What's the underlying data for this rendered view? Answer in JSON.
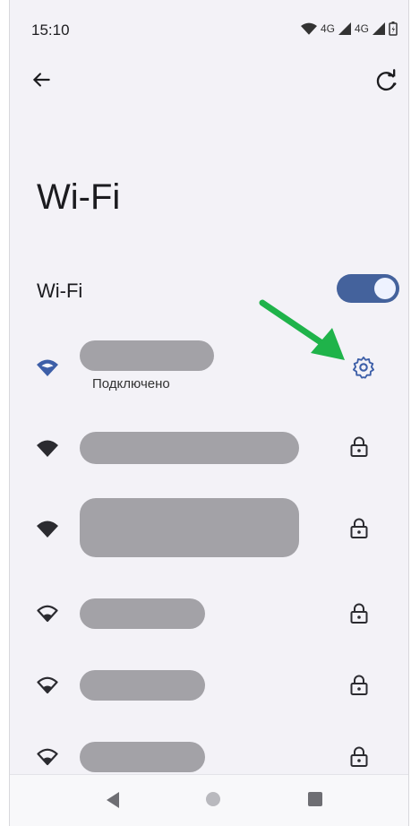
{
  "status_bar": {
    "time": "15:10",
    "network_1": "4G",
    "network_2": "4G"
  },
  "toolbar": {
    "back_icon": "arrow-back-icon",
    "refresh_icon": "refresh-icon"
  },
  "page": {
    "title": "Wi-Fi"
  },
  "wifi_toggle": {
    "label": "Wi-Fi",
    "state": "on"
  },
  "networks": [
    {
      "status": "Подключено",
      "connected": true,
      "icon": "wifi-full-blue-icon",
      "action_icon": "gear-icon"
    },
    {
      "status": "",
      "connected": false,
      "icon": "wifi-full-icon",
      "action_icon": "lock-icon"
    },
    {
      "status": "",
      "connected": false,
      "icon": "wifi-full-icon",
      "action_icon": "lock-icon"
    },
    {
      "status": "",
      "connected": false,
      "icon": "wifi-outline-icon",
      "action_icon": "lock-icon"
    },
    {
      "status": "",
      "connected": false,
      "icon": "wifi-outline-icon",
      "action_icon": "lock-icon"
    },
    {
      "status": "",
      "connected": false,
      "icon": "wifi-outline-icon",
      "action_icon": "lock-icon"
    }
  ],
  "annotation": {
    "arrow_color": "#1fb34a"
  },
  "colors": {
    "accent": "#44629c",
    "background": "#f3f2f7",
    "redaction": "#a3a2a7"
  },
  "nav_bar": {
    "back": "triangle-back-icon",
    "home": "circle-home-icon",
    "recents": "square-recents-icon"
  }
}
